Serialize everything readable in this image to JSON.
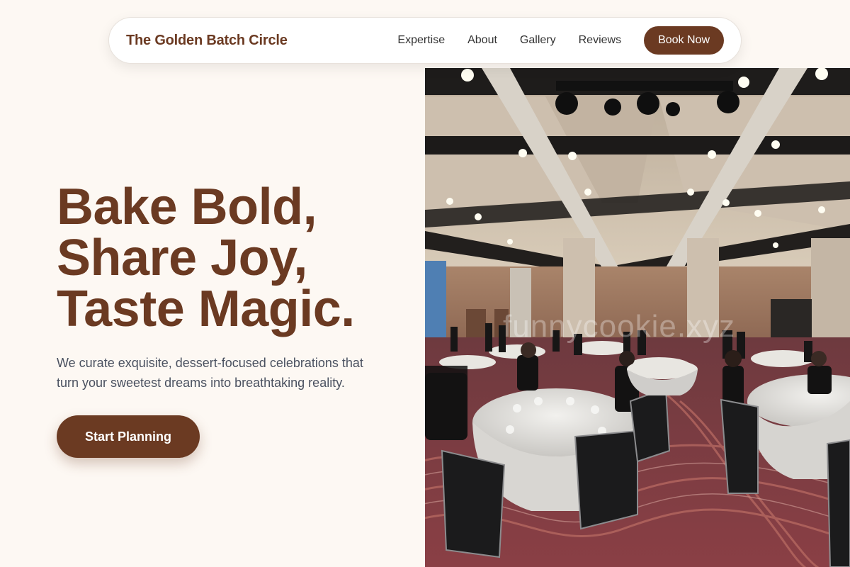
{
  "navbar": {
    "brand": "The Golden Batch Circle",
    "links": [
      {
        "label": "Expertise"
      },
      {
        "label": "About"
      },
      {
        "label": "Gallery"
      },
      {
        "label": "Reviews"
      }
    ],
    "cta_label": "Book Now"
  },
  "hero": {
    "headline_lines": [
      "Bake Bold,",
      "Share Joy,",
      "Taste Magic."
    ],
    "subtext": "We curate exquisite, dessert-focused celebrations that turn your sweetest dreams into breathtaking reality.",
    "cta_label": "Start Planning",
    "image": {
      "subject": "banquet-hall-event-photo",
      "watermark": "funnycookie.xyz"
    }
  },
  "colors": {
    "page_bg": "#fdf8f3",
    "brand_brown": "#6b3a22",
    "nav_text": "#333333",
    "body_text": "#4a5160"
  }
}
